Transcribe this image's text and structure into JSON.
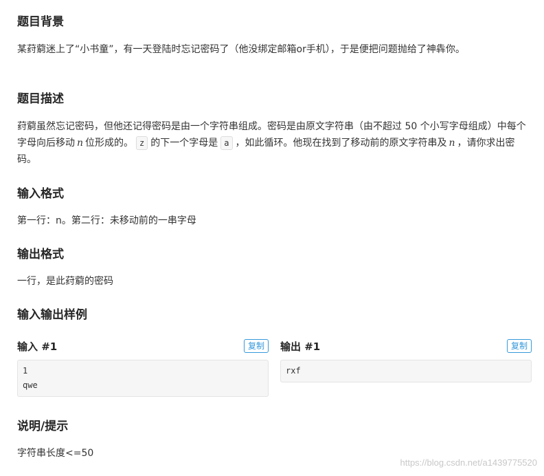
{
  "background": {
    "title": "题目背景",
    "text": "某荮藭迷上了“小书童”，有一天登陆时忘记密码了（他没绑定邮箱or手机），于是便把问题抛给了神犇你。"
  },
  "description": {
    "title": "题目描述",
    "part1": "荮藭虽然忘记密码，但他还记得密码是由一个字符串组成。密码是由原文字符串（由不超过 50 个小写字母组成）中每个字母向后移动",
    "var_n": "n",
    "part2": "位形成的。",
    "code_z": "z",
    "part3": "的下一个字母是",
    "code_a": "a",
    "part4": "，如此循环。他现在找到了移动前的原文字符串及",
    "var_n2": "n",
    "part5": "，请你求出密码。"
  },
  "input_format": {
    "title": "输入格式",
    "text": "第一行：n。第二行：未移动前的一串字母"
  },
  "output_format": {
    "title": "输出格式",
    "text": "一行，是此荮藭的密码"
  },
  "samples": {
    "title": "输入输出样例",
    "input": {
      "label": "输入 #1",
      "copy": "复制",
      "content": "1\nqwe"
    },
    "output": {
      "label": "输出 #1",
      "copy": "复制",
      "content": "rxf"
    }
  },
  "hint": {
    "title": "说明/提示",
    "text": "字符串长度<=50"
  },
  "watermark": "https://blog.csdn.net/a1439775520",
  "colors": {
    "accent": "#3498db",
    "code_bg": "#f6f6f6"
  }
}
